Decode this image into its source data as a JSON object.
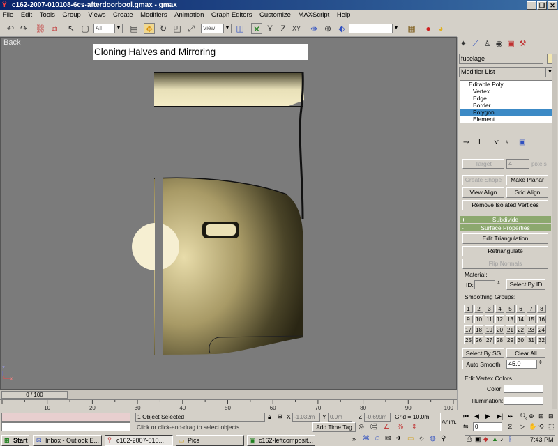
{
  "window": {
    "title": "c162-2007-010108-6cs-afterdoorbool.gmax - gmax",
    "minimize": "_",
    "restore": "❐",
    "close": "✕"
  },
  "menu": [
    "File",
    "Edit",
    "Tools",
    "Group",
    "Views",
    "Create",
    "Modifiers",
    "Animation",
    "Graph Editors",
    "Customize",
    "MAXScript",
    "Help"
  ],
  "toolbar": {
    "selection_filter": "All",
    "reference_coord": "View",
    "named_selection": ""
  },
  "viewport": {
    "label": "Back",
    "banner": "Cloning Halves and Mirroring",
    "axis_z": "z",
    "axis_x": "x"
  },
  "command_panel": {
    "object_name": "fuselage",
    "modifier_list": "Modifier List",
    "stack": [
      "Editable Poly",
      "Vertex",
      "Edge",
      "Border",
      "Polygon",
      "Element"
    ],
    "stack_selected": 4,
    "target_label": "Target",
    "target_value": "4",
    "pixels_label": "pixels",
    "create_shape": "Create Shape",
    "make_planar": "Make Planar",
    "view_align": "View Align",
    "grid_align": "Grid Align",
    "remove_isolated": "Remove Isolated Vertices",
    "subdivide": "Subdivide",
    "surface_properties": "Surface Properties",
    "edit_triangulation": "Edit Triangulation",
    "retriangulate": "Retriangulate",
    "flip_normals": "Flip Normals",
    "material_label": "Material:",
    "id_label": "ID:",
    "select_by_id": "Select By ID",
    "smoothing_groups": "Smoothing Groups:",
    "sg_numbers": [
      "1",
      "2",
      "3",
      "4",
      "5",
      "6",
      "7",
      "8",
      "9",
      "10",
      "11",
      "12",
      "13",
      "14",
      "15",
      "16",
      "17",
      "18",
      "19",
      "20",
      "21",
      "22",
      "23",
      "24",
      "25",
      "26",
      "27",
      "28",
      "29",
      "30",
      "31",
      "32"
    ],
    "select_by_sg": "Select By SG",
    "clear_all": "Clear All",
    "auto_smooth": "Auto Smooth",
    "auto_smooth_value": "45.0",
    "edit_vertex_colors": "Edit Vertex Colors",
    "color_label": "Color:",
    "illumination_label": "Illumination:"
  },
  "timeline": {
    "slider": "0 / 100",
    "ticks": [
      "10",
      "20",
      "30",
      "40",
      "50",
      "60",
      "70",
      "80",
      "90",
      "100"
    ]
  },
  "status": {
    "selected": "1 Object Selected",
    "prompt": "Click or click-and-drag to select objects",
    "x_label": "X",
    "x_value": "-1.032m",
    "y_label": "Y",
    "y_value": "0.0m",
    "z_label": "Z",
    "z_value": "-0.699m",
    "grid": "Grid = 10.0m",
    "add_time_tag": "Add Time Tag",
    "anim": "Anim.",
    "frame": "0"
  },
  "taskbar": {
    "start": "Start",
    "tasks": [
      "Inbox - Outlook E...",
      "c162-2007-010...",
      "Pics",
      "c162-leftcomposit..."
    ],
    "active_task": 1,
    "clock": "7:43 PM"
  },
  "colors": {
    "title_gradient_start": "#0a246a",
    "viewport_bg": "#7b7b7b",
    "rollout_bar": "#8ca86e",
    "stack_selection": "#3c8ac6"
  }
}
